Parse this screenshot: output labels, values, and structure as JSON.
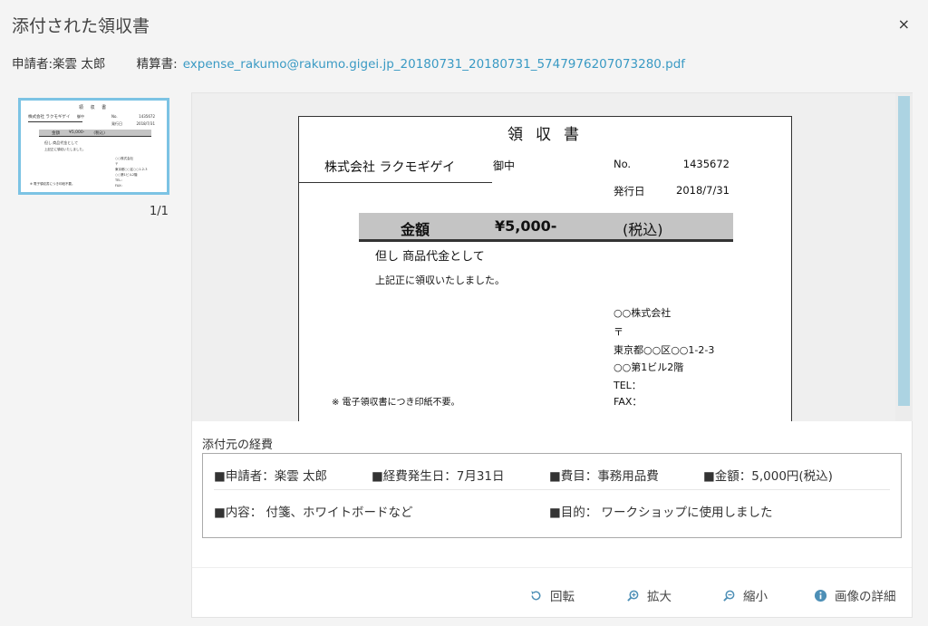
{
  "dialog": {
    "title": "添付された領収書",
    "close": "×"
  },
  "meta": {
    "applicant": "申請者:楽雲 太郎",
    "settlement_label": "精算書:",
    "settlement_file": "expense_rakumo@rakumo.gigei.jp_20180731_20180731_5747976207073280.pdf"
  },
  "thumbnail": {
    "page_indicator": "1/1"
  },
  "receipt": {
    "title": "領収書",
    "company": "株式会社 ラクモギゲイ",
    "honorific": "御中",
    "no_label": "No.",
    "no_value": "1435672",
    "date_label": "発行日",
    "date_value": "2018/7/31",
    "amount_label": "金額",
    "amount_value": "¥5,000-",
    "tax_note": "(税込)",
    "purpose": "但し 商品代金として",
    "received": "上記正に領収いたしました。",
    "issuer": "○○株式会社",
    "postal": "〒",
    "address1": "東京都○○区○○1-2-3",
    "address2": "○○第1ビル2階",
    "tel": "TEL：",
    "fax": "FAX：",
    "stamp_note": "※ 電子領収書につき印紙不要。"
  },
  "thumb_receipt": {
    "title": "領 収 書",
    "company": "株式会社 ラクモギゲイ",
    "honorific": "御中",
    "no_label": "No.",
    "no_value": "1435672",
    "date_label": "発行日",
    "date_value": "2018/7/31",
    "amount_label": "金額",
    "amount_value": "¥5,000-",
    "tax_note": "(税込)",
    "purpose": "但し 商品代金として",
    "received": "上記正に領収いたしました。",
    "issuer": "○○株式会社",
    "postal": "〒",
    "address1": "東京都○○区○○1-2-3",
    "address2": "○○第1ビル2階",
    "tel": "TEL：",
    "fax": "FAX：",
    "stamp_note": "※ 電子領収書につき印紙不要。"
  },
  "expense": {
    "heading": "添付元の経費",
    "applicant": "■申請者：楽雲 太郎",
    "date": "■経費発生日：7月31日",
    "category": "■費目：事務用品費",
    "amount": "■金額：5,000円(税込)",
    "content": "■内容： 付箋、ホワイトボードなど",
    "purpose": "■目的： ワークショップに使用しました"
  },
  "toolbar": {
    "rotate": "回転",
    "zoom_in": "拡大",
    "zoom_out": "縮小",
    "image_details": "画像の詳細"
  },
  "colors": {
    "link": "#3a9ac4",
    "thumb_border": "#7cc3e4",
    "scroll_thumb": "#acd3e2",
    "icon": "#4d8fb6"
  }
}
